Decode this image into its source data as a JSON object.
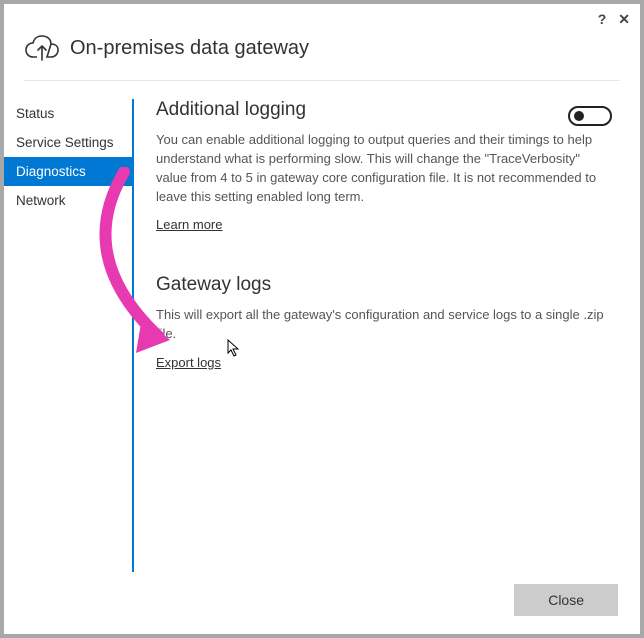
{
  "titlebar": {
    "help": "?",
    "close": "✕"
  },
  "header": {
    "title": "On-premises data gateway"
  },
  "sidebar": {
    "items": [
      {
        "label": "Status"
      },
      {
        "label": "Service Settings"
      },
      {
        "label": "Diagnostics"
      },
      {
        "label": "Network"
      }
    ]
  },
  "content": {
    "section1": {
      "title": "Additional logging",
      "desc": "You can enable additional logging to output queries and their timings to help understand what is performing slow. This will change the \"TraceVerbosity\" value from 4 to 5 in gateway core configuration file. It is not recommended to leave this setting enabled long term.",
      "link": "Learn more"
    },
    "section2": {
      "title": "Gateway logs",
      "desc": "This will export all the gateway's configuration and service logs to a single .zip file.",
      "link": "Export logs"
    }
  },
  "footer": {
    "close": "Close"
  }
}
